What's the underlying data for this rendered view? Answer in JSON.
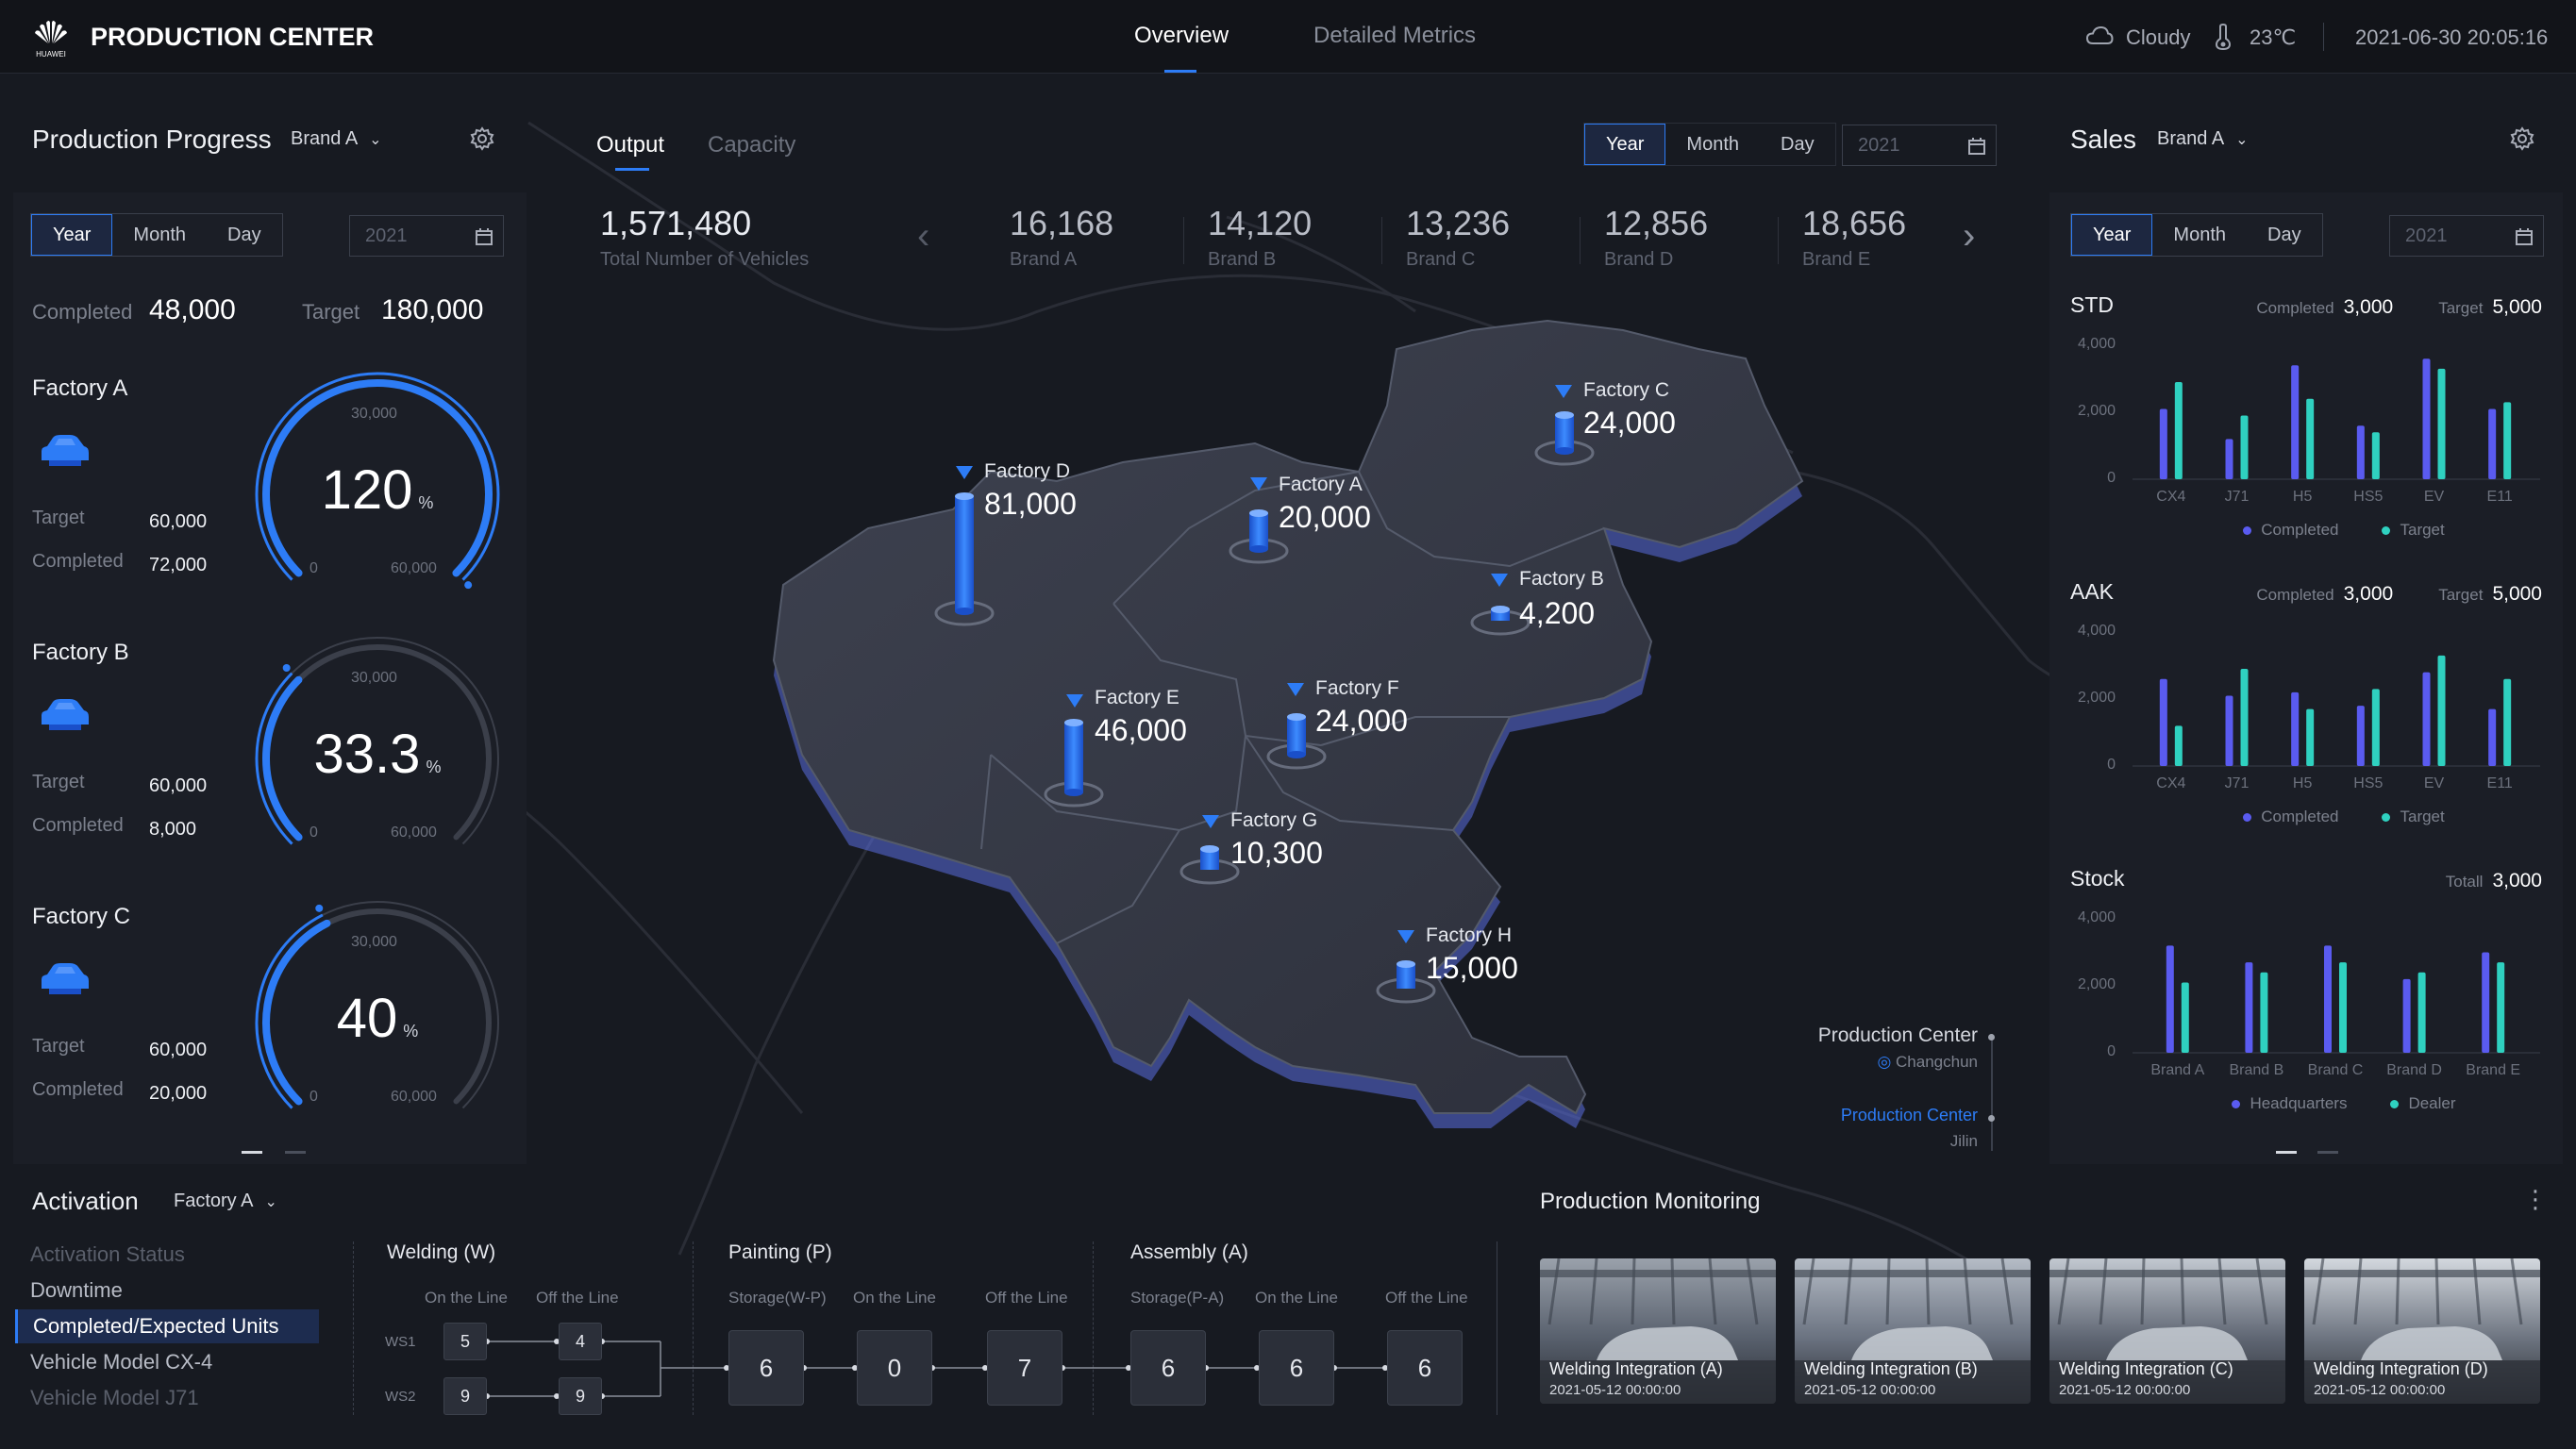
{
  "header": {
    "brand": "HUAWEI",
    "title": "PRODUCTION CENTER",
    "tabs": [
      {
        "label": "Overview",
        "active": true
      },
      {
        "label": "Detailed Metrics",
        "active": false
      }
    ],
    "weather": "Cloudy",
    "temperature": "23℃",
    "datetime": "2021-06-30 20:05:16"
  },
  "left": {
    "title": "Production Progress",
    "brand_select": "Brand A",
    "periods": [
      "Year",
      "Month",
      "Day"
    ],
    "date_value": "2021",
    "completed_label": "Completed",
    "completed_value": "48,000",
    "target_label": "Target",
    "target_value": "180,000",
    "factories": [
      {
        "name": "Factory A",
        "target_label": "Target",
        "target": "60,000",
        "completed_label": "Completed",
        "completed": "72,000",
        "percent": "120",
        "percent_unit": "%",
        "gauge_top": "30,000",
        "gauge_min": "0",
        "gauge_max": "60,000",
        "fill": 1.0
      },
      {
        "name": "Factory B",
        "target_label": "Target",
        "target": "60,000",
        "completed_label": "Completed",
        "completed": "8,000",
        "percent": "33.3",
        "percent_unit": "%",
        "gauge_top": "30,000",
        "gauge_min": "0",
        "gauge_max": "60,000",
        "fill": 0.333
      },
      {
        "name": "Factory C",
        "target_label": "Target",
        "target": "60,000",
        "completed_label": "Completed",
        "completed": "20,000",
        "percent": "40",
        "percent_unit": "%",
        "gauge_top": "30,000",
        "gauge_min": "0",
        "gauge_max": "60,000",
        "fill": 0.4
      }
    ]
  },
  "center": {
    "tabs": [
      {
        "label": "Output",
        "active": true
      },
      {
        "label": "Capacity",
        "active": false
      }
    ],
    "periods": [
      "Year",
      "Month",
      "Day"
    ],
    "date_value": "2021",
    "total_value": "1,571,480",
    "total_label": "Total Number of Vehicles",
    "brands": [
      {
        "value": "16,168",
        "label": "Brand A"
      },
      {
        "value": "14,120",
        "label": "Brand B"
      },
      {
        "value": "13,236",
        "label": "Brand C"
      },
      {
        "value": "12,856",
        "label": "Brand D"
      },
      {
        "value": "18,656",
        "label": "Brand E"
      }
    ],
    "map_factories": [
      {
        "name": "Factory D",
        "value": "81,000"
      },
      {
        "name": "Factory A",
        "value": "20,000"
      },
      {
        "name": "Factory C",
        "value": "24,000"
      },
      {
        "name": "Factory B",
        "value": "4,200"
      },
      {
        "name": "Factory E",
        "value": "46,000"
      },
      {
        "name": "Factory F",
        "value": "24,000"
      },
      {
        "name": "Factory G",
        "value": "10,300"
      },
      {
        "name": "Factory H",
        "value": "15,000"
      }
    ],
    "legend": [
      {
        "title": "Production Center",
        "sub": "Changchun"
      },
      {
        "title": "Production Center",
        "sub": "Jilin"
      }
    ]
  },
  "right": {
    "title": "Sales",
    "brand_select": "Brand A",
    "periods": [
      "Year",
      "Month",
      "Day"
    ],
    "date_value": "2021"
  },
  "chart_data": [
    {
      "type": "bar",
      "title": "STD",
      "summary": {
        "completed_label": "Completed",
        "completed": "3,000",
        "target_label": "Target",
        "target": "5,000"
      },
      "categories": [
        "CX4",
        "J71",
        "H5",
        "HS5",
        "EV",
        "E11"
      ],
      "series": [
        {
          "name": "Completed",
          "values": [
            2100,
            1200,
            3400,
            1600,
            3600,
            2100
          ],
          "color": "#5a5bf0"
        },
        {
          "name": "Target",
          "values": [
            2900,
            1900,
            2400,
            1400,
            3300,
            2300
          ],
          "color": "#2fd1c0"
        }
      ],
      "ylim": [
        0,
        4000
      ],
      "yticks": [
        "0",
        "2,000",
        "4,000"
      ]
    },
    {
      "type": "bar",
      "title": "AAK",
      "summary": {
        "completed_label": "Completed",
        "completed": "3,000",
        "target_label": "Target",
        "target": "5,000"
      },
      "categories": [
        "CX4",
        "J71",
        "H5",
        "HS5",
        "EV",
        "E11"
      ],
      "series": [
        {
          "name": "Completed",
          "values": [
            2600,
            2100,
            2200,
            1800,
            2800,
            1700
          ],
          "color": "#5a5bf0"
        },
        {
          "name": "Target",
          "values": [
            1200,
            2900,
            1700,
            2300,
            3300,
            2600
          ],
          "color": "#2fd1c0"
        }
      ],
      "ylim": [
        0,
        4000
      ],
      "yticks": [
        "0",
        "2,000",
        "4,000"
      ]
    },
    {
      "type": "bar",
      "title": "Stock",
      "summary": {
        "total_label": "Totall",
        "total": "3,000"
      },
      "categories": [
        "Brand A",
        "Brand B",
        "Brand C",
        "Brand D",
        "Brand E"
      ],
      "series": [
        {
          "name": "Headquarters",
          "values": [
            3200,
            2700,
            3200,
            2200,
            3000
          ],
          "color": "#5a5bf0"
        },
        {
          "name": "Dealer",
          "values": [
            2100,
            2400,
            2700,
            2400,
            2700
          ],
          "color": "#2fd1c0"
        }
      ],
      "ylim": [
        0,
        4000
      ],
      "yticks": [
        "0",
        "2,000",
        "4,000"
      ]
    }
  ],
  "activation": {
    "title": "Activation",
    "factory_select": "Factory A",
    "menu": [
      {
        "label": "Activation Status",
        "state": "dim"
      },
      {
        "label": "Downtime",
        "state": "normal"
      },
      {
        "label": "Completed/Expected Units",
        "state": "active"
      },
      {
        "label": "Vehicle Model CX-4",
        "state": "normal"
      },
      {
        "label": "Vehicle Model J71",
        "state": "dim"
      }
    ],
    "welding": {
      "title": "Welding (W)",
      "on_line": "On the Line",
      "off_line": "Off the Line",
      "ws1": "WS1",
      "ws2": "WS2",
      "ws1_on": "5",
      "ws1_off": "4",
      "ws2_on": "9",
      "ws2_off": "9"
    },
    "painting": {
      "title": "Painting (P)",
      "storage": "Storage(W-P)",
      "on_line": "On the Line",
      "off_line": "Off the Line",
      "storage_val": "6",
      "on_val": "0",
      "off_val": "7"
    },
    "assembly": {
      "title": "Assembly (A)",
      "storage": "Storage(P-A)",
      "on_line": "On the Line",
      "off_line": "Off the Line",
      "storage_val": "6",
      "on_val": "6",
      "off_val": "6"
    }
  },
  "monitoring": {
    "title": "Production Monitoring",
    "cameras": [
      {
        "title": "Welding Integration (A)",
        "time": "2021-05-12 00:00:00"
      },
      {
        "title": "Welding Integration (B)",
        "time": "2021-05-12 00:00:00"
      },
      {
        "title": "Welding Integration (C)",
        "time": "2021-05-12 00:00:00"
      },
      {
        "title": "Welding Integration (D)",
        "time": "2021-05-12 00:00:00"
      }
    ]
  }
}
